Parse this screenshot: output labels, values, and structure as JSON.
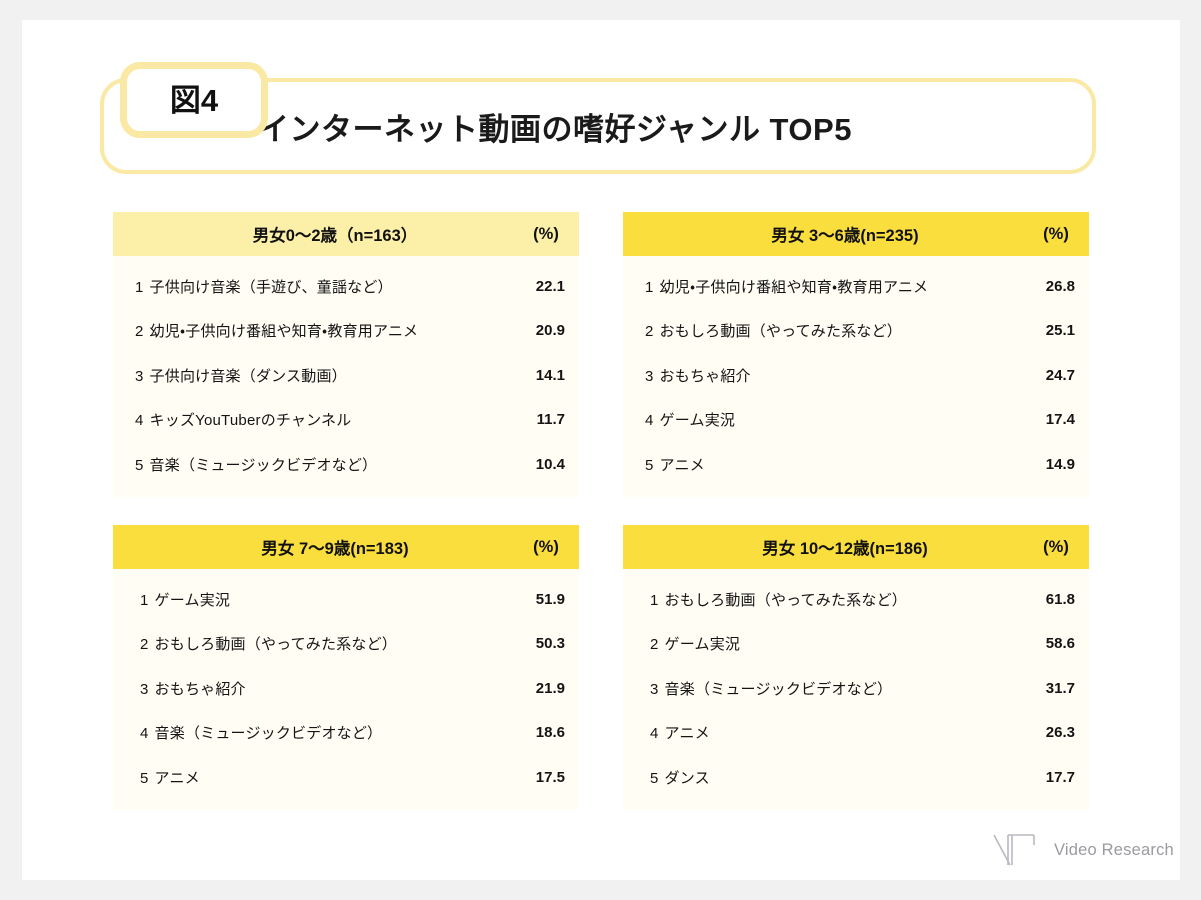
{
  "header": {
    "badge": "図4",
    "title": "インターネット動画の嗜好ジャンル TOP5"
  },
  "logo": {
    "mark": "video-research-logo-mark",
    "text": "Video Research"
  },
  "colors": {
    "page_background": "#f1f1f1",
    "card_background": "#ffffff",
    "frame_border": "#fae9a4",
    "header_pale_yellow": "#fcf0a8",
    "header_bright_yellow": "#fade3e",
    "table_body": "#fffdf4",
    "text": "#141414",
    "logo_gray": "#9a9aa2"
  },
  "chart_data": {
    "type": "table",
    "title": "インターネット動画の嗜好ジャンル TOP5",
    "unit_label": "(%)",
    "tables": [
      {
        "header": "男女0〜2歳（n=163）",
        "unit": "(%)",
        "header_color": "#fcf0a8",
        "categories": [
          "子供向け音楽（手遊び、童謡など）",
          "幼児・子供向け番組や知育・教育用アニメ",
          "子供向け音楽（ダンス動画）",
          "キッズYouTuberのチャンネル",
          "音楽（ミュージックビデオなど）"
        ],
        "ranks": [
          "1",
          "2",
          "3",
          "4",
          "5"
        ],
        "values": [
          22.1,
          20.9,
          14.1,
          11.7,
          10.4
        ]
      },
      {
        "header": "男女 3〜6歳(n=235)",
        "unit": "(%)",
        "header_color": "#fade3e",
        "categories": [
          "幼児・子供向け番組や知育・教育用アニメ",
          "おもしろ動画（やってみた系など）",
          "おもちゃ紹介",
          "ゲーム実況",
          "アニメ"
        ],
        "ranks": [
          "1",
          "2",
          "3",
          "4",
          "5"
        ],
        "values": [
          26.8,
          25.1,
          24.7,
          17.4,
          14.9
        ]
      },
      {
        "header": "男女 7〜9歳(n=183)",
        "unit": "(%)",
        "header_color": "#fade3e",
        "categories": [
          "ゲーム実況",
          "おもしろ動画（やってみた系など）",
          "おもちゃ紹介",
          "音楽（ミュージックビデオなど）",
          "アニメ"
        ],
        "ranks": [
          "1",
          "2",
          "3",
          "4",
          "5"
        ],
        "values": [
          51.9,
          50.3,
          21.9,
          18.6,
          17.5
        ]
      },
      {
        "header": "男女 10〜12歳(n=186)",
        "unit": "(%)",
        "header_color": "#fade3e",
        "categories": [
          "おもしろ動画（やってみた系など）",
          "ゲーム実況",
          "音楽（ミュージックビデオなど）",
          "アニメ",
          "ダンス"
        ],
        "ranks": [
          "1",
          "2",
          "3",
          "4",
          "5"
        ],
        "values": [
          61.8,
          58.6,
          31.7,
          26.3,
          17.7
        ]
      }
    ]
  }
}
